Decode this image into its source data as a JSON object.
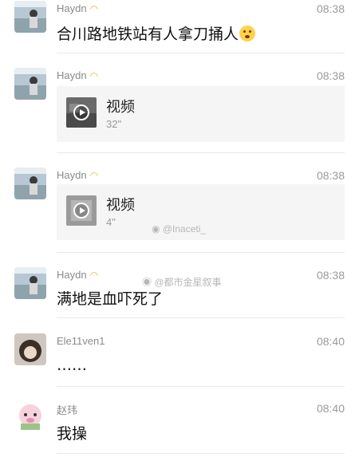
{
  "messages": [
    {
      "sender": "Haydn",
      "time": "08:38",
      "text": "合川路地铁站有人拿刀捅人"
    },
    {
      "sender": "Haydn",
      "time": "08:38",
      "video": {
        "label": "视频",
        "duration": "32\""
      }
    },
    {
      "sender": "Haydn",
      "time": "08:38",
      "video": {
        "label": "视频",
        "duration": "4\""
      }
    },
    {
      "sender": "Haydn",
      "time": "08:38",
      "text": "满地是血吓死了"
    },
    {
      "sender": "Ele11ven1",
      "time": "08:40",
      "text": "……"
    },
    {
      "sender": "赵玮",
      "time": "08:40",
      "text": "我操"
    }
  ],
  "icons": {
    "name_badge": "banana-emoji-icon",
    "flushed_emoji": "flushed-face-emoji-icon",
    "play": "play-icon"
  },
  "watermarks": {
    "one": "@Inaceti_",
    "two": "@都市金星叙事"
  },
  "colors": {
    "name": "#8a8a8a",
    "time": "#9a9a9a",
    "video_bg": "#f5f5f5",
    "separator": "#e8e8e8"
  }
}
